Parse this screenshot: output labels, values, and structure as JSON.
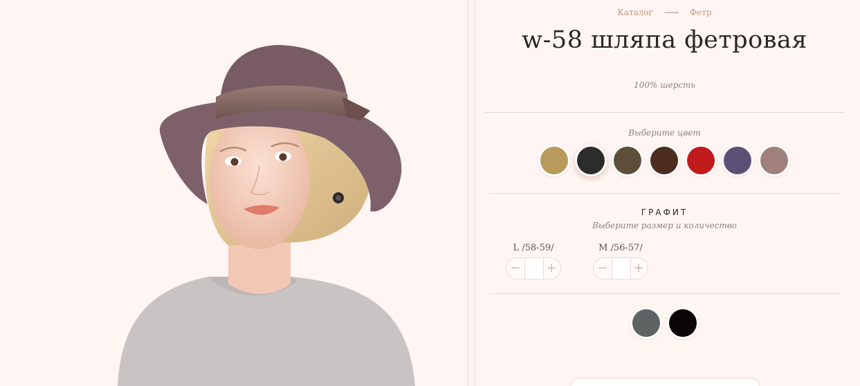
{
  "breadcrumb": {
    "catalog": "Каталог",
    "arrow": "⟶",
    "current": "Фетр"
  },
  "product": {
    "title": "w-58 шляпа фетровая",
    "material": "100% шерсть"
  },
  "colors": {
    "prompt": "Выберите цвет",
    "selected_name": "ГРАФИТ",
    "swatches": [
      "#b99a5d",
      "#2c2c2c",
      "#5e4d38",
      "#4b2e1f",
      "#c01b1c",
      "#5c5076",
      "#a0807c"
    ],
    "selected_index": 1
  },
  "sizes": {
    "prompt": "Выберите размер и количество",
    "items": [
      {
        "label": "L /58-59/",
        "qty": ""
      },
      {
        "label": "M /56-57/",
        "qty": ""
      }
    ],
    "minus": "−",
    "plus": "+"
  },
  "extra_swatches": [
    "#5e6463",
    "#0b0607"
  ]
}
